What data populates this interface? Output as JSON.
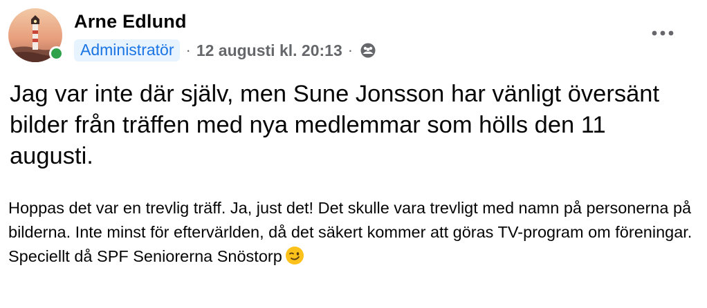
{
  "post": {
    "author": {
      "name": "Arne Edlund",
      "role": "Administratör",
      "online": true,
      "avatar_icon": "lighthouse-avatar"
    },
    "meta": {
      "separator": "·",
      "timestamp": "12 augusti kl. 20:13",
      "audience_icon": "group-members-icon"
    },
    "more_icon": "more-options-icon",
    "headline_text": "Jag var inte där själv, men Sune Jonsson har vänligt översänt bilder från träffen med nya medlemmar som hölls den 11 augusti.",
    "body_text": "Hoppas det var en trevlig träff. Ja, just det! Det skulle vara trevligt med namn på personerna på bilderna. Inte minst för eftervärlden, då det säkert kommer att göras TV-program om föreningar. Speciellt då SPF Seniorerna Snöstorp",
    "body_emoji": "winking-face-emoji"
  },
  "colors": {
    "badge_bg": "#e7f3ff",
    "badge_text": "#1b74e4",
    "secondary_text": "#65676b",
    "online": "#31a24c"
  }
}
